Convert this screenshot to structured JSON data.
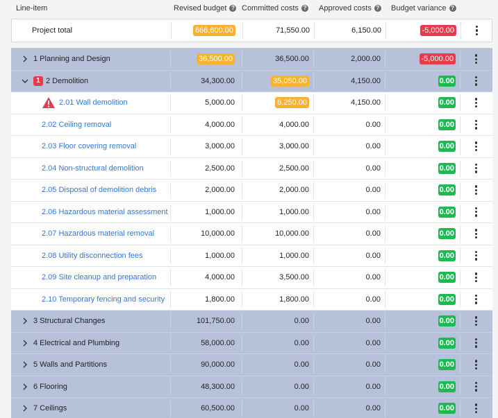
{
  "header": {
    "line_item": "Line-item",
    "revised_budget": "Revised budget",
    "committed_costs": "Committed costs",
    "approved_costs": "Approved costs",
    "budget_variance": "Budget variance"
  },
  "total": {
    "label": "Project total",
    "revised": "666,600.00",
    "committed": "71,550.00",
    "approved": "6,150.00",
    "variance": "-5,000.00"
  },
  "rows": [
    {
      "kind": "group",
      "chevron": "chevron-right-icon",
      "label": "1 Planning and Design",
      "revised": "36,500.00",
      "revised_badge": "orange",
      "committed": "36,500.00",
      "committed_badge": "",
      "approved": "2,000.00",
      "variance": "-5,000.00",
      "variance_badge": "red"
    },
    {
      "kind": "group",
      "chevron": "chevron-down-icon",
      "count": "1",
      "label": "2 Demolition",
      "revised": "34,300.00",
      "revised_badge": "",
      "committed": "35,050.00",
      "committed_badge": "orange",
      "approved": "4,150.00",
      "variance": "0.00",
      "variance_badge": "green"
    },
    {
      "kind": "child",
      "warning": true,
      "label": "2.01 Wall demolition",
      "revised": "5,000.00",
      "revised_badge": "",
      "committed": "6,250.00",
      "committed_badge": "orange",
      "approved": "4,150.00",
      "variance": "0.00",
      "variance_badge": "green"
    },
    {
      "kind": "child",
      "label": "2.02 Ceiling removal",
      "revised": "4,000.00",
      "revised_badge": "",
      "committed": "4,000.00",
      "committed_badge": "",
      "approved": "0.00",
      "variance": "0.00",
      "variance_badge": "green"
    },
    {
      "kind": "child",
      "label": "2.03 Floor covering removal",
      "revised": "3,000.00",
      "revised_badge": "",
      "committed": "3,000.00",
      "committed_badge": "",
      "approved": "0.00",
      "variance": "0.00",
      "variance_badge": "green"
    },
    {
      "kind": "child",
      "label": "2.04 Non-structural demolition",
      "revised": "2,500.00",
      "revised_badge": "",
      "committed": "2,500.00",
      "committed_badge": "",
      "approved": "0.00",
      "variance": "0.00",
      "variance_badge": "green"
    },
    {
      "kind": "child",
      "label": "2.05 Disposal of demolition debris",
      "revised": "2,000.00",
      "revised_badge": "",
      "committed": "2,000.00",
      "committed_badge": "",
      "approved": "0.00",
      "variance": "0.00",
      "variance_badge": "green"
    },
    {
      "kind": "child",
      "label": "2.06 Hazardous material assessment",
      "revised": "1,000.00",
      "revised_badge": "",
      "committed": "1,000.00",
      "committed_badge": "",
      "approved": "0.00",
      "variance": "0.00",
      "variance_badge": "green"
    },
    {
      "kind": "child",
      "label": "2.07 Hazardous material removal",
      "revised": "10,000.00",
      "revised_badge": "",
      "committed": "10,000.00",
      "committed_badge": "",
      "approved": "0.00",
      "variance": "0.00",
      "variance_badge": "green"
    },
    {
      "kind": "child",
      "label": "2.08 Utility disconnection fees",
      "revised": "1,000.00",
      "revised_badge": "",
      "committed": "1,000.00",
      "committed_badge": "",
      "approved": "0.00",
      "variance": "0.00",
      "variance_badge": "green"
    },
    {
      "kind": "child",
      "label": "2.09 Site cleanup and preparation",
      "revised": "4,000.00",
      "revised_badge": "",
      "committed": "3,500.00",
      "committed_badge": "",
      "approved": "0.00",
      "variance": "0.00",
      "variance_badge": "green"
    },
    {
      "kind": "child",
      "label": "2.10 Temporary fencing and security",
      "revised": "1,800.00",
      "revised_badge": "",
      "committed": "1,800.00",
      "committed_badge": "",
      "approved": "0.00",
      "variance": "0.00",
      "variance_badge": "green"
    },
    {
      "kind": "group",
      "chevron": "chevron-right-icon",
      "label": "3 Structural Changes",
      "revised": "101,750.00",
      "revised_badge": "",
      "committed": "0.00",
      "committed_badge": "",
      "approved": "0.00",
      "variance": "0.00",
      "variance_badge": "green"
    },
    {
      "kind": "group",
      "chevron": "chevron-right-icon",
      "label": "4 Electrical and Plumbing",
      "revised": "58,000.00",
      "revised_badge": "",
      "committed": "0.00",
      "committed_badge": "",
      "approved": "0.00",
      "variance": "0.00",
      "variance_badge": "green"
    },
    {
      "kind": "group",
      "chevron": "chevron-right-icon",
      "label": "5 Walls and Partitions",
      "revised": "90,000.00",
      "revised_badge": "",
      "committed": "0.00",
      "committed_badge": "",
      "approved": "0.00",
      "variance": "0.00",
      "variance_badge": "green"
    },
    {
      "kind": "group",
      "chevron": "chevron-right-icon",
      "label": "6 Flooring",
      "revised": "48,300.00",
      "revised_badge": "",
      "committed": "0.00",
      "committed_badge": "",
      "approved": "0.00",
      "variance": "0.00",
      "variance_badge": "green"
    },
    {
      "kind": "group",
      "chevron": "chevron-right-icon",
      "label": "7 Ceilings",
      "revised": "60,500.00",
      "revised_badge": "",
      "committed": "0.00",
      "committed_badge": "",
      "approved": "0.00",
      "variance": "0.00",
      "variance_badge": "green"
    }
  ],
  "colors": {
    "group_row": "#b7c1d9",
    "badge_orange": "#f7b22f",
    "badge_red": "#e53b4d",
    "badge_green": "#1dba54",
    "link": "#3478d4"
  }
}
